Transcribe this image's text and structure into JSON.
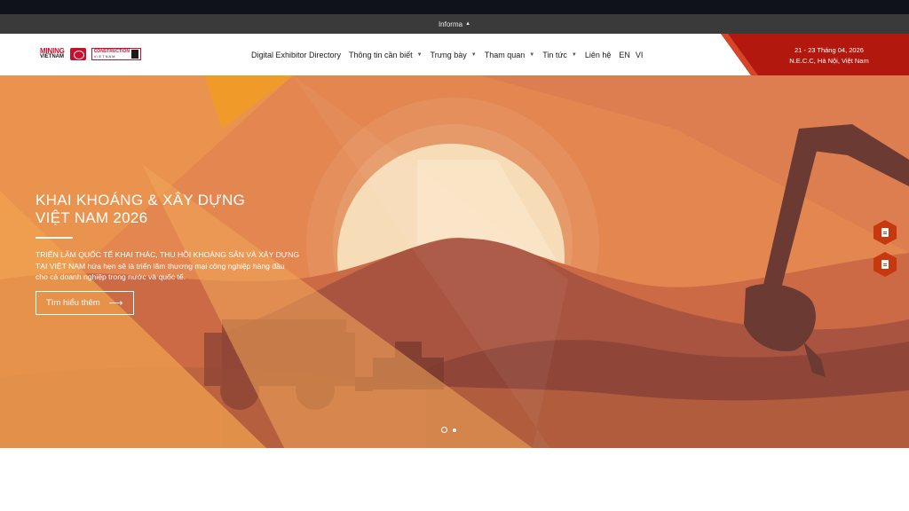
{
  "informa_bar": {
    "label": "Informa",
    "caret": "▲"
  },
  "logos": {
    "mining_line1": "MINING",
    "mining_line2": "VIETNAM",
    "construction_line1": "CONSTRUCTION",
    "construction_line2": "VIETNAM"
  },
  "nav": {
    "items": [
      {
        "label": "Digital Exhibitor Directory",
        "dropdown": false
      },
      {
        "label": "Thông tin cần biết",
        "dropdown": true
      },
      {
        "label": "Trưng bày",
        "dropdown": true
      },
      {
        "label": "Tham quan",
        "dropdown": true
      },
      {
        "label": "Tin tức",
        "dropdown": true
      },
      {
        "label": "Liên hệ",
        "dropdown": false
      }
    ],
    "dropdown_glyph": "▼",
    "lang_en": "EN",
    "lang_vi": "VI"
  },
  "event": {
    "dates": "21 - 23 Tháng 04, 2026",
    "venue": "N.E.C.C, Hà Nội, Việt Nam"
  },
  "hero": {
    "title_line1": "KHAI KHOÁNG & XÂY DỰNG",
    "title_line2": "VIỆT NAM 2026",
    "desc_line1": "TRIỂN LÃM QUỐC TẾ KHAI THÁC, THU HỒI KHOÁNG SẢN VÀ XÂY DỰNG",
    "desc_line2": "TẠI VIỆT NAM hứa hẹn sẽ là triển lãm thương mại công nghiệp hàng đầu",
    "desc_line3": "cho cả doanh nghiệp trong nước và quốc tế.",
    "button_label": "Tìm hiểu thêm",
    "button_arrow": "⟶"
  },
  "carousel": {
    "active_index": 0,
    "count": 2
  },
  "side_buttons": [
    {
      "icon": "clipboard-icon"
    },
    {
      "icon": "id-badge-icon"
    }
  ],
  "colors": {
    "header_bg": "#ffffff",
    "top_bar": "#0f1218",
    "informa_bar": "#3a3a3a",
    "event_red": "#b3180e",
    "hero_orange": "#e07a44",
    "side_button": "#c8380f"
  }
}
